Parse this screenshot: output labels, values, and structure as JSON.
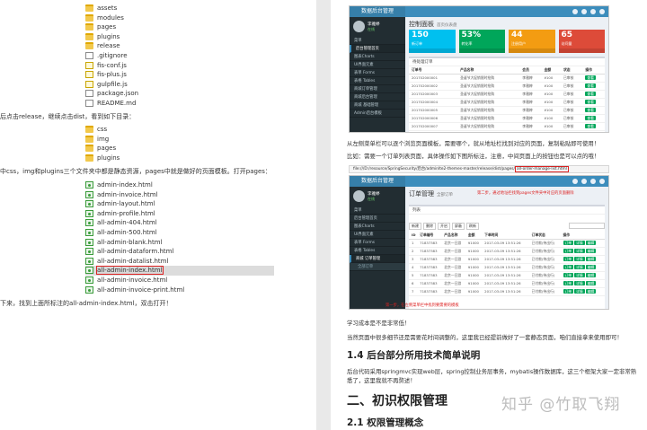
{
  "left": {
    "tree1": [
      "assets",
      "modules",
      "pages",
      "plugins",
      "release",
      ".gitignore",
      "fis-conf.js",
      "fis-plus.js",
      "gulpfile.js",
      "package.json",
      "README.md"
    ],
    "para1": "后点击release，继续点击dist，看到如下目录：",
    "tree2": [
      "css",
      "img",
      "pages",
      "plugins"
    ],
    "para2": "中css，img和plugins三个文件夹中都是静态资源，pages中就是做好的页面模板。打开pages：",
    "tree3": [
      "admin-index.html",
      "admin-invoice.html",
      "admin-layout.html",
      "admin-profile.html",
      "all-admin-404.html",
      "all-admin-500.html",
      "all-admin-blank.html",
      "all-admin-dataform.html",
      "all-admin-datalist.html",
      "all-admin-index.html",
      "all-admin-invoice.html",
      "all-admin-invoice-print.html"
    ],
    "para3": "下来，找到上面所标注的all-admin-index.html，双击打开！"
  },
  "right": {
    "shot1": {
      "brand": "数据后台管理",
      "title": "控制面板",
      "subtitle": "首页仪表盘",
      "user": "李雅婷",
      "status": "在线",
      "boxes": [
        {
          "value": "150",
          "label": "新订单",
          "color": "#00c0ef"
        },
        {
          "value": "53%",
          "label": "转化率",
          "color": "#00a65a"
        },
        {
          "value": "44",
          "label": "注册用户",
          "color": "#f39c12"
        },
        {
          "value": "65",
          "label": "访问量",
          "color": "#dd4b39"
        }
      ],
      "menu": [
        "菜单",
        "后台管理首页",
        "图表Charts",
        "UI界面元素",
        "表单 Forms",
        "表格 Tables",
        "商城订单管理",
        "商城后台管理",
        "商城 基础管理",
        "Admin后台模板"
      ],
      "panel_title": "待处理订单",
      "columns": [
        "订单号",
        "产品名称",
        "会员",
        "金额",
        "状态",
        "操作"
      ],
      "rows": [
        [
          "201702000001",
          "圣诞节大促销限时抢购",
          "李雅婷",
          "¥100",
          "已审核"
        ],
        [
          "201702000002",
          "圣诞节大促销限时抢购",
          "李雅婷",
          "¥100",
          "已审核"
        ],
        [
          "201702000003",
          "圣诞节大促销限时抢购",
          "李雅婷",
          "¥100",
          "已审核"
        ],
        [
          "201702000004",
          "圣诞节大促销限时抢购",
          "李雅婷",
          "¥100",
          "已审核"
        ],
        [
          "201702000005",
          "圣诞节大促销限时抢购",
          "李雅婷",
          "¥100",
          "已审核"
        ],
        [
          "201702000006",
          "圣诞节大促销限时抢购",
          "李雅婷",
          "¥100",
          "已审核"
        ],
        [
          "201702000007",
          "圣诞节大促销限时抢购",
          "李雅婷",
          "¥100",
          "已审核"
        ],
        [
          "201702000008",
          "圣诞节大促销限时抢购",
          "李雅婷",
          "¥100",
          "已审核"
        ]
      ],
      "action": "查看"
    },
    "cap1": "从左侧菜单栏可以逐个浏览页面模板，需要哪个，就从地址栏找到对应的页面，复制粘贴即可使用！",
    "cap2": "比如：需要一个订单列表页面，具体操作如下图所标注，注意，中间页面上的按钮也是可以点的哦！",
    "url": "file:///D:/resource/SpringSecurity/后台/adminlte2-themes-master/release/dist/pages/",
    "url_hl": "all-order-manage-list.html",
    "note1": "第二步，通过地址栏找到pages文件夹中对应的页面删除",
    "shot2": {
      "brand": "数据后台管理",
      "title": "订单管理",
      "subtitle": "全部订单",
      "user": "李雅婷",
      "status": "在线",
      "tab": "列表",
      "tools": [
        "新建",
        "删除",
        "开启",
        "屏蔽",
        "刷新"
      ],
      "menu": [
        "菜单",
        "后台管理首页",
        "图表Charts",
        "UI界面元素",
        "表单 Forms",
        "表格 Tables",
        "商城 订单管理",
        "全部订单"
      ],
      "columns": [
        "ID",
        "订单编号",
        "产品名称",
        "金额",
        "下单时间",
        "订单状态",
        "操作"
      ],
      "rows": [
        [
          "1",
          "71837383",
          "北京一日游",
          "¥1000",
          "2017-03-09 13:51:26",
          "已付款(待出行)"
        ],
        [
          "2",
          "71837383",
          "北京一日游",
          "¥1000",
          "2017-03-09 13:51:26",
          "已付款(待出行)"
        ],
        [
          "3",
          "71837383",
          "北京一日游",
          "¥1000",
          "2017-03-09 13:51:26",
          "已付款(待出行)"
        ],
        [
          "4",
          "71837383",
          "北京一日游",
          "¥1000",
          "2017-03-09 13:51:26",
          "已付款(待出行)"
        ],
        [
          "5",
          "71837383",
          "北京一日游",
          "¥1000",
          "2017-03-09 13:51:26",
          "已付款(待出行)"
        ],
        [
          "6",
          "71837383",
          "北京一日游",
          "¥1000",
          "2017-03-09 13:51:26",
          "已付款(待出行)"
        ],
        [
          "7",
          "71837383",
          "北京一日游",
          "¥1000",
          "2017-03-09 13:51:26",
          "已付款(待出行)"
        ]
      ],
      "actions": [
        "订单",
        "详情",
        "编辑"
      ]
    },
    "note2": "第一步，在左侧菜单栏中找到要需要的模板",
    "cap3": "学习成本是不是非常低！",
    "cap4": "当然页面中很多细节还是需要花时间调整的，这里我已经提前做好了一套静态页面，咱们直接拿来使用即可！",
    "h_14": "1.4 后台部分所用技术简单说明",
    "p_14a": "后台代码采用springmvc实现web层，spring控制业务层事务，mybatis操作数据库，这三个框架大家一定非常熟",
    "p_14b": "悉了，这里我就不再赘述！",
    "h_2": "二、初识权限管理",
    "h_21": "2.1 权限管理概念",
    "watermark": "知乎 @竹取飞翔"
  }
}
